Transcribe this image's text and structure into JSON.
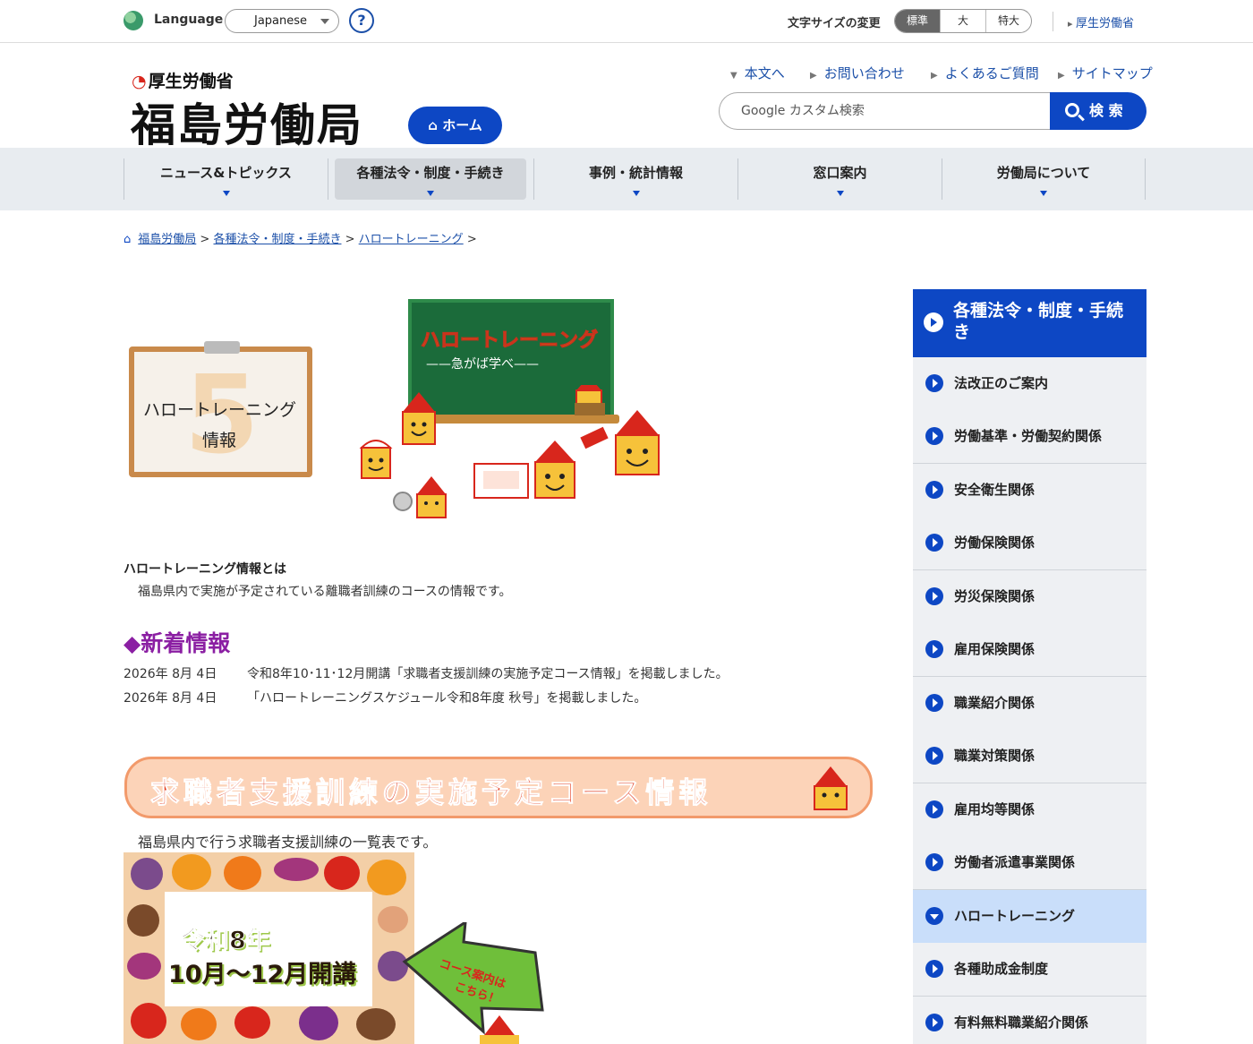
{
  "topbar": {
    "language_label": "Language",
    "language_value": "Japanese",
    "help": "?",
    "font_size_label": "文字サイズの変更",
    "font_sizes": [
      "標準",
      "大",
      "特大"
    ],
    "mhlw_link": "厚生労働省"
  },
  "header": {
    "ministry": "厚生労働省",
    "bureau": "福島労働局",
    "home_button": "ホーム",
    "links": [
      "本文へ",
      "お問い合わせ",
      "よくあるご質問",
      "サイトマップ"
    ],
    "search_placeholder": "Google カスタム検索",
    "search_button": "検 索"
  },
  "nav": {
    "items": [
      "ニュース&トピックス",
      "各種法令・制度・手続き",
      "事例・統計情報",
      "窓口案内",
      "労働局について"
    ],
    "active_index": 1
  },
  "breadcrumb": {
    "items": [
      "福島労働局",
      "各種法令・制度・手続き",
      "ハロートレーニング"
    ],
    "separator": ">"
  },
  "main": {
    "clipboard_number": "5",
    "clipboard_line1": "ハロートレーニング",
    "clipboard_line2": "情報",
    "chalk_title": "ハロートレーニング",
    "chalk_sub": "——急がば学べ——",
    "about_heading": "ハロートレーニング情報とは",
    "about_text": "福島県内で実施が予定されている離職者訓練のコースの情報です。",
    "news_heading": "◆新着情報",
    "news": [
      {
        "date": "2026年 8月  4日",
        "text": "令和8年10･11･12月開講「求職者支援訓練の実施予定コース情報」を掲載しました。"
      },
      {
        "date": "2026年 8月  4日",
        "text": "「ハロートレーニングスケジュール令和8年度 秋号」を掲載しました。"
      }
    ],
    "banner_text": "求職者支援訓練の実施予定コース情報",
    "list_desc": "福島県内で行う求職者支援訓練の一覧表です。",
    "harvest_line1": "令和8年",
    "harvest_line2": "10月～12月開講",
    "arrow_text": "コース案内は\nこちら！"
  },
  "sidebar": {
    "heading": "各種法令・制度・手続き",
    "items": [
      "法改正のご案内",
      "労働基準・労働契約関係",
      "安全衛生関係",
      "労働保険関係",
      "労災保険関係",
      "雇用保険関係",
      "職業紹介関係",
      "職業対策関係",
      "雇用均等関係",
      "労働者派遣事業関係",
      "ハロートレーニング",
      "各種助成金制度",
      "有料無料職業紹介関係"
    ],
    "active_index": 10
  },
  "colors": {
    "brand_blue": "#0d47c4",
    "news_purple": "#8b1fa3",
    "banner_orange": "#e23b1e"
  }
}
